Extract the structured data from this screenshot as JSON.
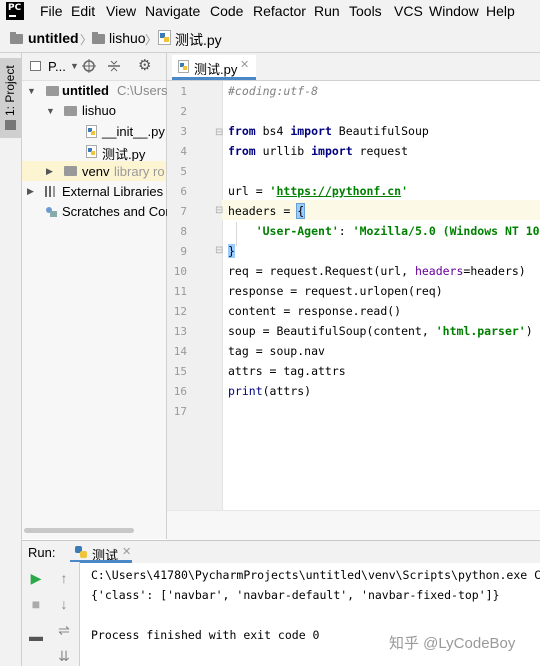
{
  "app": {
    "logo": "PC"
  },
  "menu": [
    "File",
    "Edit",
    "View",
    "Navigate",
    "Code",
    "Refactor",
    "Run",
    "Tools",
    "VCS",
    "Window",
    "Help"
  ],
  "breadcrumb": {
    "project": "untitled",
    "folder": "lishuo",
    "file": "测试.py"
  },
  "tool_strip": {
    "project_tab": "1: Project"
  },
  "project_panel": {
    "title": "P...",
    "tree": [
      {
        "label": "untitled",
        "hint": "C:\\Users"
      },
      {
        "label": "lishuo"
      },
      {
        "label": "__init__.py"
      },
      {
        "label": "测试.py"
      },
      {
        "label": "venv",
        "hint": "library ro"
      },
      {
        "label": "External Libraries"
      },
      {
        "label": "Scratches and Cor"
      }
    ]
  },
  "editor": {
    "tab_label": "测试.py",
    "line_numbers": [
      "1",
      "2",
      "3",
      "4",
      "5",
      "6",
      "7",
      "8",
      "9",
      "10",
      "11",
      "12",
      "13",
      "14",
      "15",
      "16",
      "17"
    ],
    "lines": {
      "l1": "#coding:utf-8",
      "l3a": "from",
      "l3b": " bs4 ",
      "l3c": "import",
      "l3d": " BeautifulSoup",
      "l4a": "from",
      "l4b": " urllib ",
      "l4c": "import",
      "l4d": " request",
      "l6a": "url = ",
      "l6b": "'",
      "l6c": "https://pythonf.cn",
      "l6d": "'",
      "l7a": "headers = ",
      "l7b": "{",
      "l8a": "    ",
      "l8b": "'User-Agent'",
      "l8c": ": ",
      "l8d": "'Mozilla/5.0 (Windows NT 10",
      "l9": "}",
      "l10a": "req = request.Request(url, ",
      "l10b": "headers",
      "l10c": "=headers)",
      "l11": "response = request.urlopen(req)",
      "l12": "content = response.read()",
      "l13a": "soup = BeautifulSoup(content, ",
      "l13b": "'html.parser'",
      "l13c": ")",
      "l14": "tag = soup.nav",
      "l15": "attrs = tag.attrs",
      "l16a": "print",
      "l16b": "(attrs)"
    }
  },
  "run_panel": {
    "label": "Run:",
    "tab": "测试",
    "output": [
      "C:\\Users\\41780\\PycharmProjects\\untitled\\venv\\Scripts\\python.exe C",
      "{'class': ['navbar', 'navbar-default', 'navbar-fixed-top']}",
      "",
      "Process finished with exit code 0"
    ]
  },
  "watermark": "知乎 @LyCodeBoy"
}
